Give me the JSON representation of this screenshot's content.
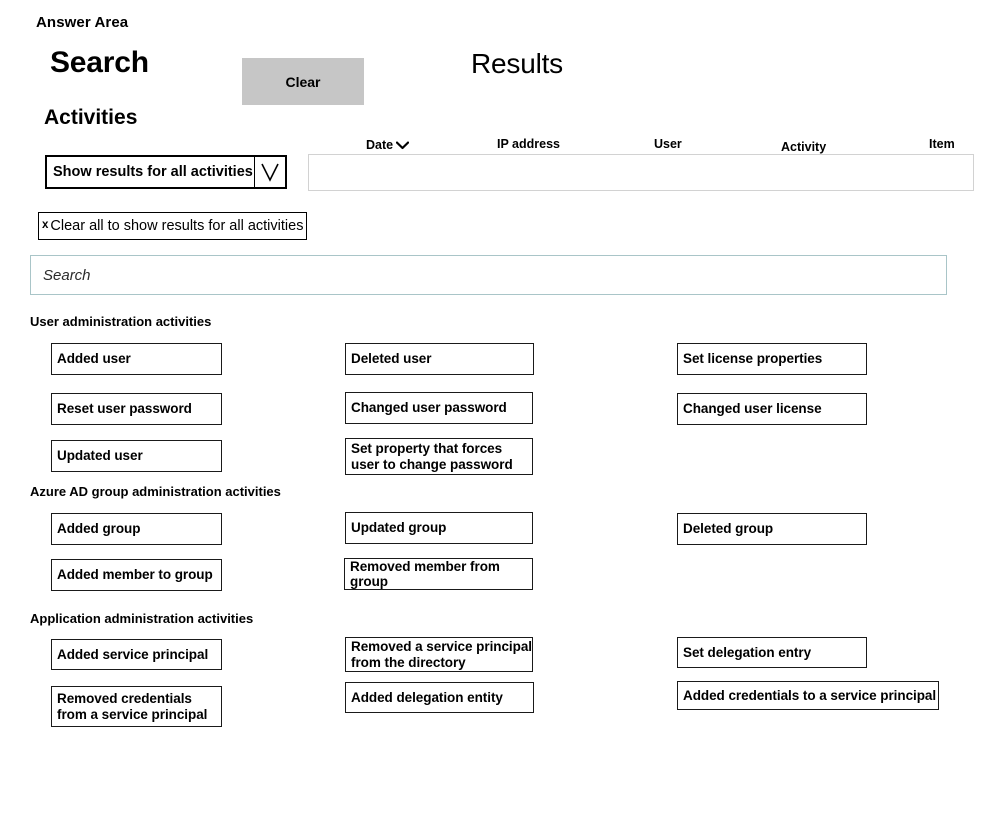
{
  "page": {
    "answer_area_label": "Answer Area"
  },
  "header": {
    "search_title": "Search",
    "clear_button": "Clear",
    "results_title": "Results"
  },
  "activities_panel": {
    "title": "Activities",
    "dropdown_value": "Show results for all activities",
    "dropdown_icon": "chevron-down-icon",
    "clear_all_chip": {
      "close_glyph": "x",
      "label": "Clear all to show results for all activities"
    },
    "search_placeholder": "Search",
    "search_value": ""
  },
  "results_table": {
    "columns": [
      {
        "label": "Date",
        "sort_icon": "chevron-down-icon"
      },
      {
        "label": "IP address"
      },
      {
        "label": "User"
      },
      {
        "label": "Activity"
      },
      {
        "label": "Item"
      }
    ],
    "rows": []
  },
  "activity_groups": [
    {
      "title": "User administration activities",
      "items": [
        "Added user",
        "Deleted user",
        "Set license properties",
        "Reset user password",
        "Changed user password",
        "Changed user license",
        "Updated user",
        "Set property that forces user to change password"
      ]
    },
    {
      "title": "Azure AD group administration activities",
      "items": [
        "Added group",
        "Updated group",
        "Deleted group",
        "Added member to group",
        "Removed member from group"
      ]
    },
    {
      "title": "Application administration activities",
      "items": [
        "Added service principal",
        "Removed a service principal from the directory",
        "Set delegation entry",
        "Removed credentials from a service principal",
        "Added delegation entity",
        "Added credentials to a service principal"
      ]
    }
  ],
  "colors": {
    "clear_button_bg": "#c6c6c6",
    "box_border": "#1a1a1a",
    "search_border": "#a9c5c8",
    "table_border": "#d2d2d2"
  }
}
